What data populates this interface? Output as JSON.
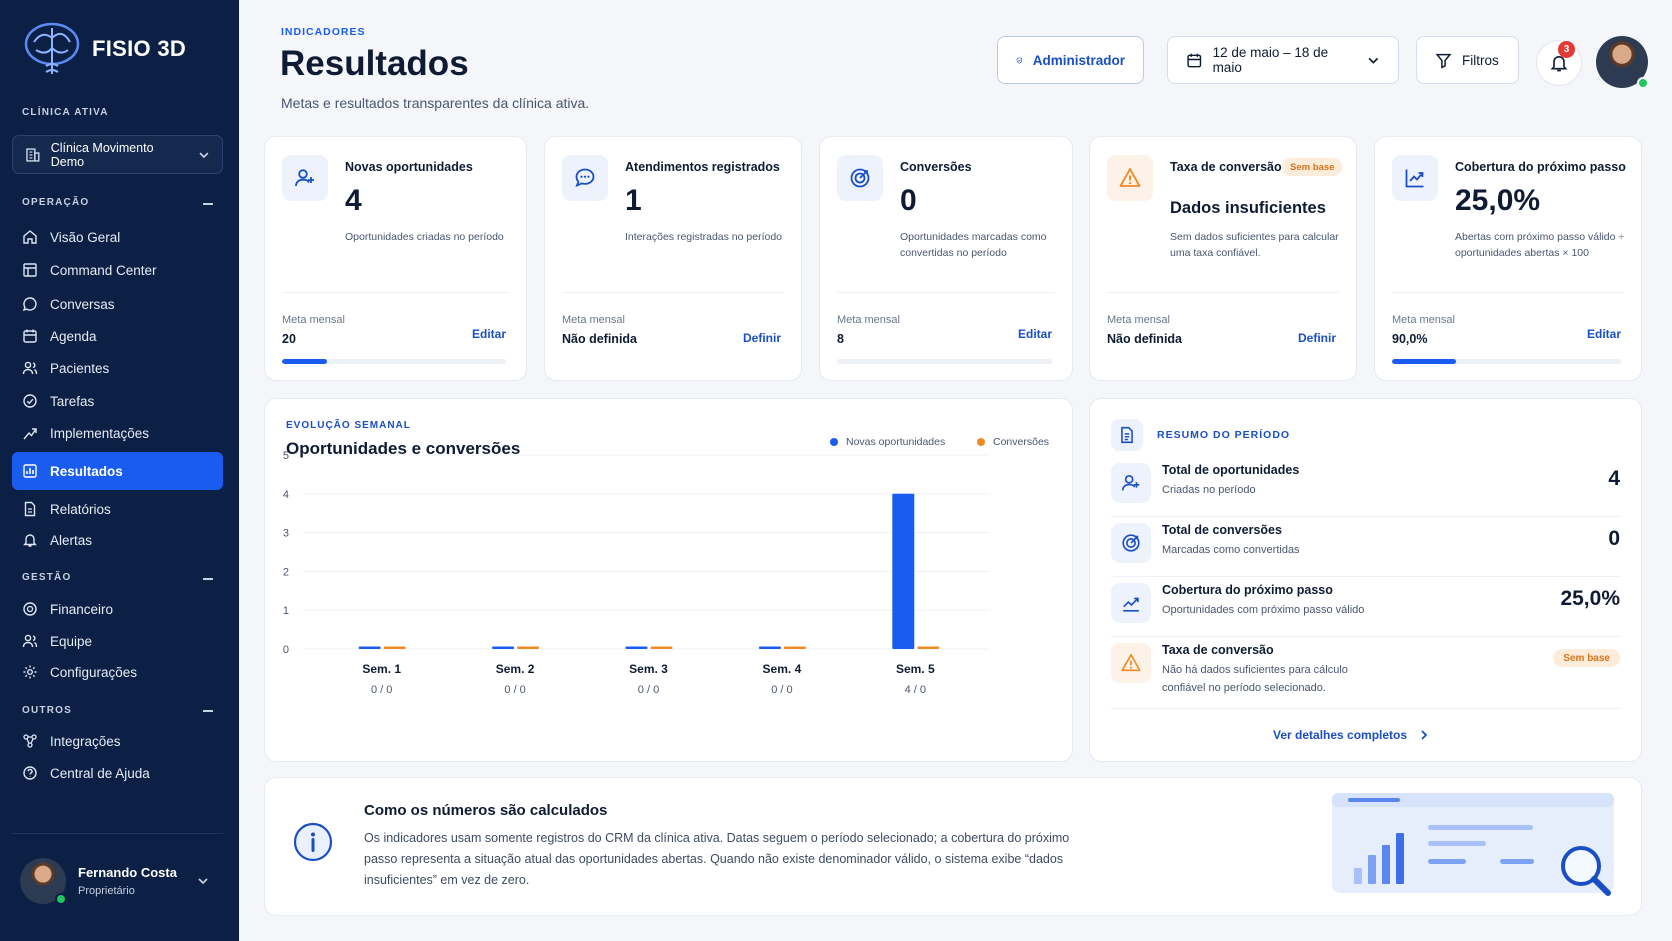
{
  "brand": {
    "name": "FISIO 3D"
  },
  "sidebar": {
    "clinic_label": "CLÍNICA ATIVA",
    "clinic_name": "Clínica Movimento Demo",
    "sections": {
      "operacao": "OPERAÇÃO",
      "gestao": "GESTÃO",
      "outros": "OUTROS"
    },
    "items": [
      {
        "label": "Visão Geral",
        "icon": "home-icon"
      },
      {
        "label": "Command Center",
        "icon": "command-center-icon"
      },
      {
        "label": "Conversas",
        "icon": "chat-icon"
      },
      {
        "label": "Agenda",
        "icon": "calendar-icon"
      },
      {
        "label": "Pacientes",
        "icon": "users-icon"
      },
      {
        "label": "Tarefas",
        "icon": "check-circle-icon"
      },
      {
        "label": "Implementações",
        "icon": "trend-icon"
      },
      {
        "label": "Resultados",
        "icon": "bar-chart-icon",
        "active": true
      },
      {
        "label": "Relatórios",
        "icon": "document-icon"
      },
      {
        "label": "Alertas",
        "icon": "bell-icon"
      },
      {
        "label": "Financeiro",
        "icon": "money-icon"
      },
      {
        "label": "Equipe",
        "icon": "team-icon"
      },
      {
        "label": "Configurações",
        "icon": "gear-icon"
      },
      {
        "label": "Integrações",
        "icon": "integration-icon"
      },
      {
        "label": "Central de Ajuda",
        "icon": "help-icon"
      }
    ],
    "user": {
      "name": "Fernando Costa",
      "role": "Proprietário"
    }
  },
  "header": {
    "eyebrow": "INDICADORES",
    "title": "Resultados",
    "subtitle": "Metas e resultados transparentes da clínica ativa.",
    "admin_label": "Administrador",
    "date_range": "12 de maio – 18 de maio",
    "filters_label": "Filtros",
    "notification_count": "3"
  },
  "kpis": [
    {
      "title": "Novas oportunidades",
      "value": "4",
      "desc": "Oportunidades criadas no período",
      "meta_label": "Meta mensal",
      "meta_value": "20",
      "action": "Editar",
      "progress": 0.2,
      "icon": "user-plus-icon"
    },
    {
      "title": "Atendimentos registrados",
      "value": "1",
      "desc": "Interações registradas no período",
      "meta_label": "Meta mensal",
      "meta_value": "Não definida",
      "action": "Definir",
      "icon": "chat-bubbles-icon"
    },
    {
      "title": "Conversões",
      "value": "0",
      "desc": "Oportunidades marcadas como convertidas no período",
      "meta_label": "Meta mensal",
      "meta_value": "8",
      "action": "Editar",
      "progress": 0,
      "icon": "target-icon"
    },
    {
      "title": "Taxa de conversão",
      "pill": "Sem base",
      "value": "Dados insuficientes",
      "desc": "Sem dados suficientes para calcular uma taxa confiável.",
      "meta_label": "Meta mensal",
      "meta_value": "Não definida",
      "action": "Definir",
      "icon": "warning-icon"
    },
    {
      "title": "Cobertura do próximo passo",
      "value": "25,0%",
      "desc": "Abertas com próximo passo válido ÷ oportunidades abertas × 100",
      "meta_label": "Meta mensal",
      "meta_value": "90,0%",
      "action": "Editar",
      "progress": 0.278,
      "icon": "trend-up-icon"
    }
  ],
  "chart": {
    "eyebrow": "EVOLUÇÃO SEMANAL",
    "title": "Oportunidades e conversões"
  },
  "chart_data": {
    "type": "bar",
    "title": "Oportunidades e conversões",
    "categories": [
      "Sem. 1",
      "Sem. 2",
      "Sem. 3",
      "Sem. 4",
      "Sem. 5"
    ],
    "sublabels": [
      "0 / 0",
      "0 / 0",
      "0 / 0",
      "0 / 0",
      "4 / 0"
    ],
    "series": [
      {
        "name": "Novas oportunidades",
        "values": [
          0,
          0,
          0,
          0,
          4
        ],
        "color": "#1a5cf0"
      },
      {
        "name": "Conversões",
        "values": [
          0,
          0,
          0,
          0,
          0
        ],
        "color": "#f08a24"
      }
    ],
    "ylim": [
      0,
      5
    ],
    "yticks": [
      "0",
      "1",
      "2",
      "3",
      "4",
      "5"
    ],
    "grid": true,
    "legend": "top-right"
  },
  "summary": {
    "title": "RESUMO DO PERÍODO",
    "rows": [
      {
        "title": "Total de oportunidades",
        "sub": "Criadas no período",
        "value": "4",
        "icon": "user-plus-icon"
      },
      {
        "title": "Total de conversões",
        "sub": "Marcadas como convertidas",
        "value": "0",
        "icon": "target-icon"
      },
      {
        "title": "Cobertura do próximo passo",
        "sub": "Oportunidades com próximo passo válido",
        "value": "25,0%",
        "icon": "trend-up-icon"
      },
      {
        "title": "Taxa de conversão",
        "sub": "Não há dados suficientes para cálculo confiável no período selecionado.",
        "pill": "Sem base",
        "icon": "warning-icon"
      }
    ],
    "link": "Ver detalhes completos"
  },
  "info": {
    "title": "Como os números são calculados",
    "text": "Os indicadores usam somente registros do CRM da clínica ativa. Datas seguem o período selecionado; a cobertura do próximo passo representa a situação atual das oportunidades abertas. Quando não existe denominador válido, o sistema exibe “dados insuficientes” em vez de zero."
  },
  "colors": {
    "sidebar": "#0c1f44",
    "accent": "#1a5cf0",
    "warning": "#f08a24"
  }
}
